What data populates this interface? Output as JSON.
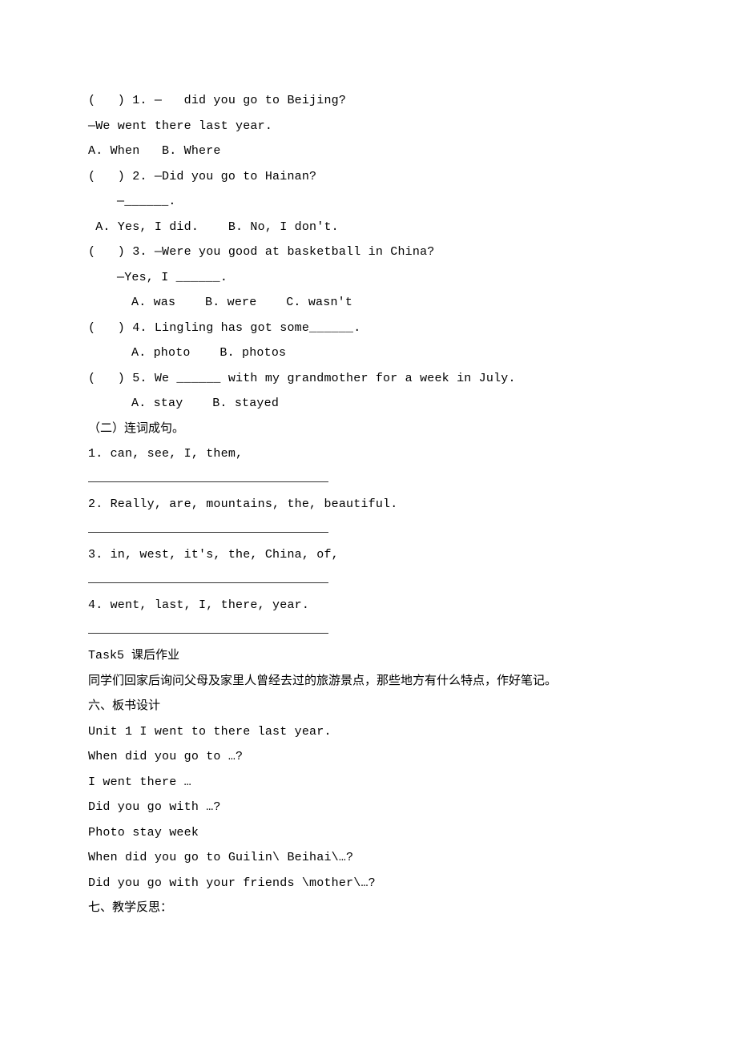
{
  "q1": {
    "line": "(   ) 1. —   did you go to Beijing?",
    "line2": "—We went there last year.",
    "opts": "A. When   B. Where"
  },
  "q2": {
    "line": "(   ) 2. —Did you go to Hainan?",
    "line2": "—______.",
    "opts": " A. Yes, I did.    B. No, I don't."
  },
  "q3": {
    "line": "(   ) 3. —Were you good at basketball in China?",
    "line2": "—Yes, I ______.",
    "opts": "A. was    B. were    C. wasn't"
  },
  "q4": {
    "line": "(   ) 4. Lingling has got some______.",
    "opts": "A. photo    B. photos"
  },
  "q5": {
    "line": "(   ) 5. We ______ with my grandmother for a week in July.",
    "opts": "A. stay    B. stayed"
  },
  "section2": {
    "title": "（二）连词成句。",
    "s1": "1. can, see, I, them,",
    "s2": "2. Really, are, mountains, the, beautiful.",
    "s3": "3. in, west, it's, the, China, of,",
    "s4": "4. went, last, I, there, year."
  },
  "task5": {
    "heading": "Task5 课后作业",
    "body": "同学们回家后询问父母及家里人曾经去过的旅游景点，那些地方有什么特点，作好笔记。"
  },
  "section6": {
    "title": "六、板书设计",
    "l1": "Unit 1 I went to there last year.",
    "l2": "When did you go to …?",
    "l3": "I went there …",
    "l4": "Did you go with …?",
    "l5": "Photo stay week",
    "l6": "When did you go to Guilin\\ Beihai\\…?",
    "l7": "Did you go with your friends \\mother\\…?"
  },
  "section7": {
    "title": "七、教学反思："
  }
}
